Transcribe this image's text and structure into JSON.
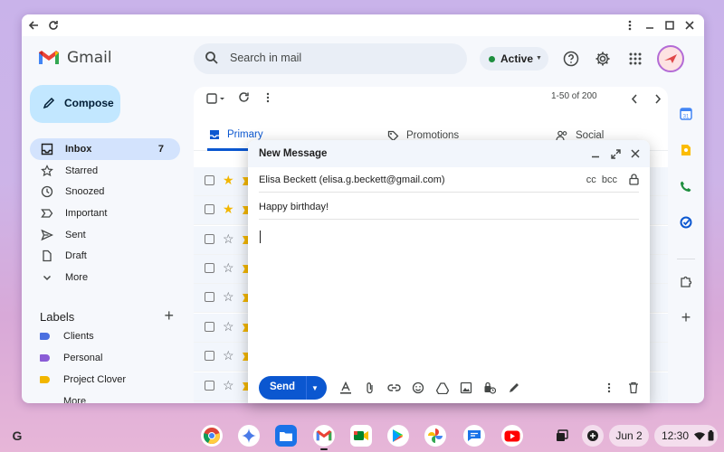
{
  "browser": {
    "back_icon": "arrow-left-icon",
    "reload_icon": "reload-icon"
  },
  "gmail": {
    "logo_text": "Gmail",
    "search": {
      "placeholder": "Search in mail"
    },
    "status": {
      "label": "Active",
      "color": "#1e8e3e"
    },
    "compose_label": "Compose",
    "nav": [
      {
        "label": "Inbox",
        "count": "7",
        "icon": "inbox-icon",
        "active": true
      },
      {
        "label": "Starred",
        "icon": "star-icon"
      },
      {
        "label": "Snoozed",
        "icon": "clock-icon"
      },
      {
        "label": "Important",
        "icon": "label-important-icon"
      },
      {
        "label": "Sent",
        "icon": "send-icon"
      },
      {
        "label": "Draft",
        "icon": "draft-icon"
      },
      {
        "label": "More",
        "icon": "chevron-down-icon"
      }
    ],
    "labels_title": "Labels",
    "labels": [
      {
        "label": "Clients",
        "color": "#4a6fe0"
      },
      {
        "label": "Personal",
        "color": "#8a5cd6"
      },
      {
        "label": "Project Clover",
        "color": "#f2b600"
      },
      {
        "label": "More",
        "color": ""
      }
    ],
    "pager": "1-50 of 200",
    "tabs": [
      {
        "label": "Primary",
        "icon": "inbox-icon",
        "active": true
      },
      {
        "label": "Promotions",
        "icon": "tag-icon"
      },
      {
        "label": "Social",
        "icon": "people-icon"
      }
    ],
    "rows_starred": [
      true,
      true,
      false,
      false,
      false,
      false,
      false,
      false,
      false
    ],
    "accent": "#0b57d0"
  },
  "composer": {
    "title": "New Message",
    "to": "Elisa Beckett (elisa.g.beckett@gmail.com)",
    "cc_bcc": "cc  bcc",
    "subject": "Happy birthday!",
    "send_label": "Send"
  },
  "shelf": {
    "launcher": "G",
    "date": "Jun 2",
    "time": "12:30"
  }
}
